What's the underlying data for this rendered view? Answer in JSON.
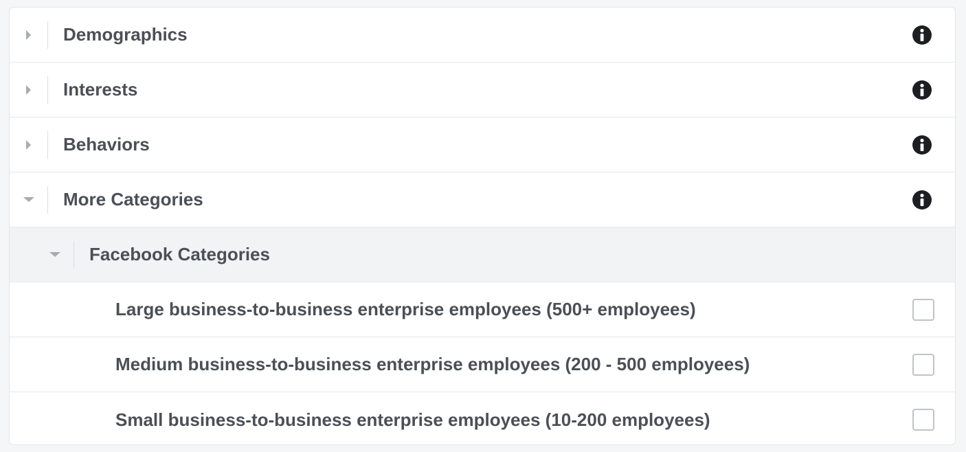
{
  "categories": [
    {
      "label": "Demographics",
      "state": "collapsed",
      "icon": "info-icon"
    },
    {
      "label": "Interests",
      "state": "collapsed",
      "icon": "info-icon"
    },
    {
      "label": "Behaviors",
      "state": "collapsed",
      "icon": "info-icon"
    },
    {
      "label": "More Categories",
      "state": "expanded",
      "icon": "info-icon"
    }
  ],
  "subcategory": {
    "label": "Facebook Categories",
    "state": "expanded"
  },
  "options": [
    {
      "label": "Large business-to-business enterprise employees (500+ employees)",
      "checked": false
    },
    {
      "label": "Medium business-to-business enterprise employees (200 - 500 employees)",
      "checked": false
    },
    {
      "label": "Small business-to-business enterprise employees (10-200 employees)",
      "checked": false
    }
  ],
  "colors": {
    "text": "#4b4f56",
    "info_icon": "#1c1e21",
    "caret": "#a8abaf",
    "sub_row_bg": "#f2f3f5"
  }
}
